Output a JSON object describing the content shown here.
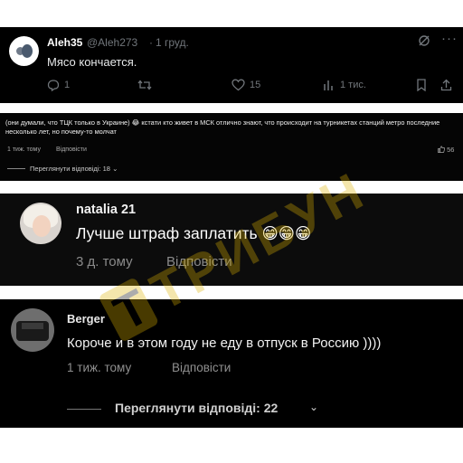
{
  "x_post": {
    "author_name": "Aleh35",
    "handle": "@Aleh273",
    "separator": "·",
    "date": "1 груд.",
    "text": "Мясо кончается.",
    "replies": "1",
    "likes": "15",
    "views": "1 тис.",
    "icons": [
      "grok-icon",
      "more-icon",
      "reply-icon",
      "repost-icon",
      "like-icon",
      "views-icon",
      "bookmark-icon",
      "share-icon"
    ]
  },
  "yt_comment": {
    "text": "(они думали, что ТЦК только в Украине) 😂 кстати кто живет в МСК отлично знают, что происходит на турникетах станций метро последние несколько лет, но почему-то молчат",
    "time": "1 тиж. тому",
    "reply": "Відповісти",
    "likes": "56",
    "view_replies": "Переглянути відповіді: 18"
  },
  "tiktok_comment_1": {
    "name": "natalia 21",
    "text": "Лучше штраф заплатить 😁😁😁",
    "time": "3 д. тому",
    "reply": "Відповісти"
  },
  "tiktok_comment_2": {
    "name": "Berger",
    "text": "Короче и в этом году не еду в отпуск в Россию ))))",
    "time": "1 тиж. тому",
    "reply": "Відповісти",
    "view_replies": "Переглянути відповіді: 22"
  },
  "watermark": {
    "text": "ТРИБУН",
    "logo_letter": "Т",
    "color": "#e0b400"
  }
}
